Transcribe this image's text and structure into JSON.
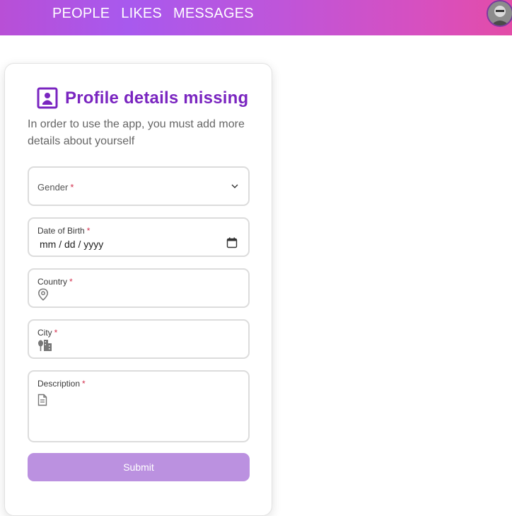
{
  "nav": {
    "items": [
      {
        "label": "PEOPLE"
      },
      {
        "label": "LIKES"
      },
      {
        "label": "MESSAGES"
      }
    ]
  },
  "colors": {
    "accent": "#7a25c0",
    "submit_disabled": "#bb91e0",
    "required_star": "#d32f4d"
  },
  "form": {
    "title": "Profile details missing",
    "subtitle": "In order to use the app, you must add more details about yourself",
    "gender": {
      "label": "Gender",
      "required": "*",
      "icon": "chevron-down-icon"
    },
    "dob": {
      "label": "Date of Birth",
      "required": "*",
      "value": "mm / dd / yyyy",
      "icon": "calendar-icon"
    },
    "country": {
      "label": "Country",
      "required": "*",
      "icon": "location-pin-icon"
    },
    "city": {
      "label": "City",
      "required": "*",
      "icon": "city-icon"
    },
    "description": {
      "label": "Description",
      "required": "*",
      "icon": "document-icon"
    },
    "submit_label": "Submit"
  }
}
